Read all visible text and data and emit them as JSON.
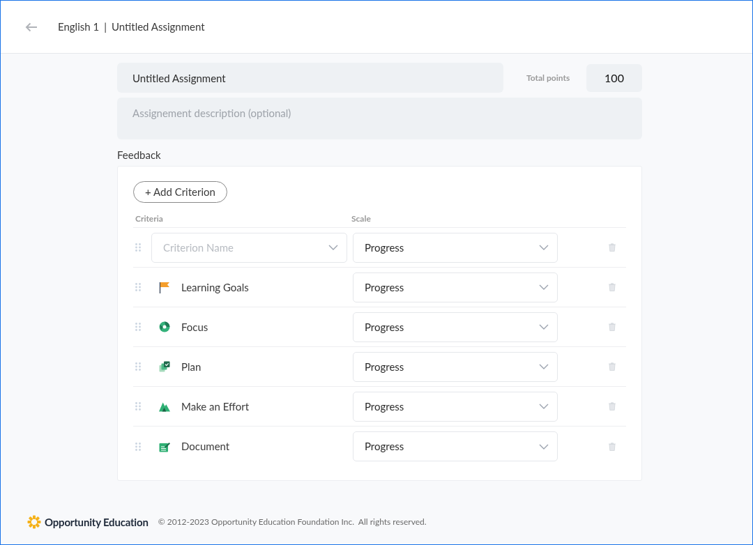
{
  "header": {
    "course": "English 1",
    "separator": "|",
    "title": "Untitled Assignment"
  },
  "assignment": {
    "title_value": "Untitled Assignment",
    "points_label": "Total points",
    "points_value": "100",
    "description_placeholder": "Assignement description (optional)"
  },
  "feedback": {
    "label": "Feedback",
    "add_button": "+ Add Criterion",
    "columns": [
      "Criteria",
      "Scale"
    ],
    "rows": [
      {
        "kind": "select",
        "placeholder": "Criterion Name",
        "scale": "Progress"
      },
      {
        "kind": "criterion",
        "name": "Learning Goals",
        "scale": "Progress"
      },
      {
        "kind": "criterion",
        "name": "Focus",
        "scale": "Progress"
      },
      {
        "kind": "criterion",
        "name": "Plan",
        "scale": "Progress"
      },
      {
        "kind": "criterion",
        "name": "Make an Effort",
        "scale": "Progress"
      },
      {
        "kind": "criterion",
        "name": "Document",
        "scale": "Progress"
      }
    ]
  },
  "footer": {
    "brand": "Opportunity Education",
    "copyright": "© 2012-2023 Opportunity Education Foundation Inc.  All rights reserved."
  }
}
